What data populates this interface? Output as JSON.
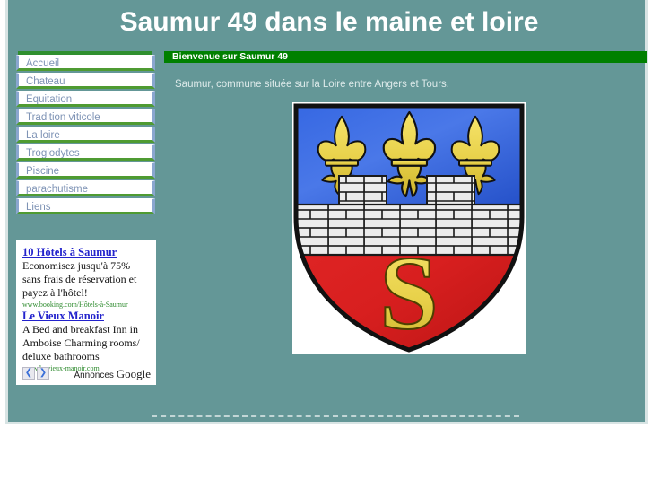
{
  "site": {
    "title": "Saumur 49 dans le maine et loire",
    "header_bg": "#649797",
    "accent_green": "#008000"
  },
  "nav": {
    "items": [
      {
        "label": "Accueil"
      },
      {
        "label": "Chateau"
      },
      {
        "label": "Equitation"
      },
      {
        "label": "Tradition viticole"
      },
      {
        "label": "La loire"
      },
      {
        "label": "Troglodytes"
      },
      {
        "label": "Piscine"
      },
      {
        "label": "parachutisme"
      },
      {
        "label": "Liens"
      }
    ]
  },
  "content": {
    "banner": "Bienvenue sur Saumur 49",
    "intro": "Saumur, commune située sur la Loire entre Angers et Tours.",
    "image_alt": "Blason de Saumur"
  },
  "ads": {
    "items": [
      {
        "title": "10 Hôtels à Saumur",
        "body": "Economisez jusqu'à 75% sans frais de réservation et payez à l'hôtel!",
        "url": "www.booking.com/Hôtels-à-Saumur"
      },
      {
        "title": "Le Vieux Manoir",
        "body": "A Bed and breakfast Inn in Amboise Charming rooms/ deluxe bathrooms",
        "url": "www.le-vieux-manoir.com"
      }
    ],
    "prev_label": "❮",
    "next_label": "❯",
    "provider_prefix": "Annonces ",
    "provider_brand": "Google"
  },
  "blason": {
    "field_blue": "#2b5edb",
    "field_red": "#d81f1f",
    "wall_white": "#ececec",
    "gold": "#ebd44a",
    "outline": "#111111"
  }
}
